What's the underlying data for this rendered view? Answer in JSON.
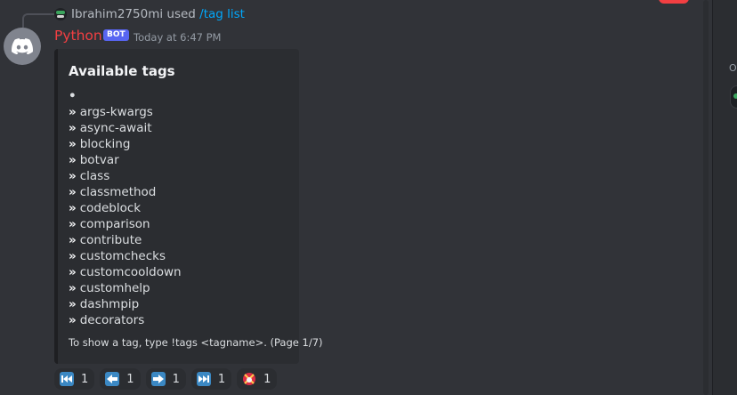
{
  "reply": {
    "username": "Ibrahim2750mi",
    "used": "used",
    "command": "/tag list"
  },
  "message": {
    "author": "Python",
    "author_color": "#f23f42",
    "bot_badge": "BOT",
    "timestamp": "Today at 6:47 PM"
  },
  "embed": {
    "title": "Available tags",
    "first_line": "•",
    "tags": [
      "args-kwargs",
      "async-await",
      "blocking",
      "botvar",
      "class",
      "classmethod",
      "codeblock",
      "comparison",
      "contribute",
      "customchecks",
      "customcooldown",
      "customhelp",
      "dashmpip",
      "decorators"
    ],
    "prefix": "»",
    "footer": "To show a tag, type !tags <tagname>. (Page 1/7)"
  },
  "reactions": [
    {
      "icon": "first-page-icon",
      "count": "1"
    },
    {
      "icon": "previous-page-icon",
      "count": "1"
    },
    {
      "icon": "next-page-icon",
      "count": "1"
    },
    {
      "icon": "last-page-icon",
      "count": "1"
    },
    {
      "icon": "stop-icon",
      "count": "1"
    }
  ],
  "colors": {
    "background": "#313338",
    "embed_background": "#2b2d31",
    "link": "#00a8fc",
    "bot_badge": "#5865f2",
    "reaction_emoji": "#3b88c3"
  }
}
